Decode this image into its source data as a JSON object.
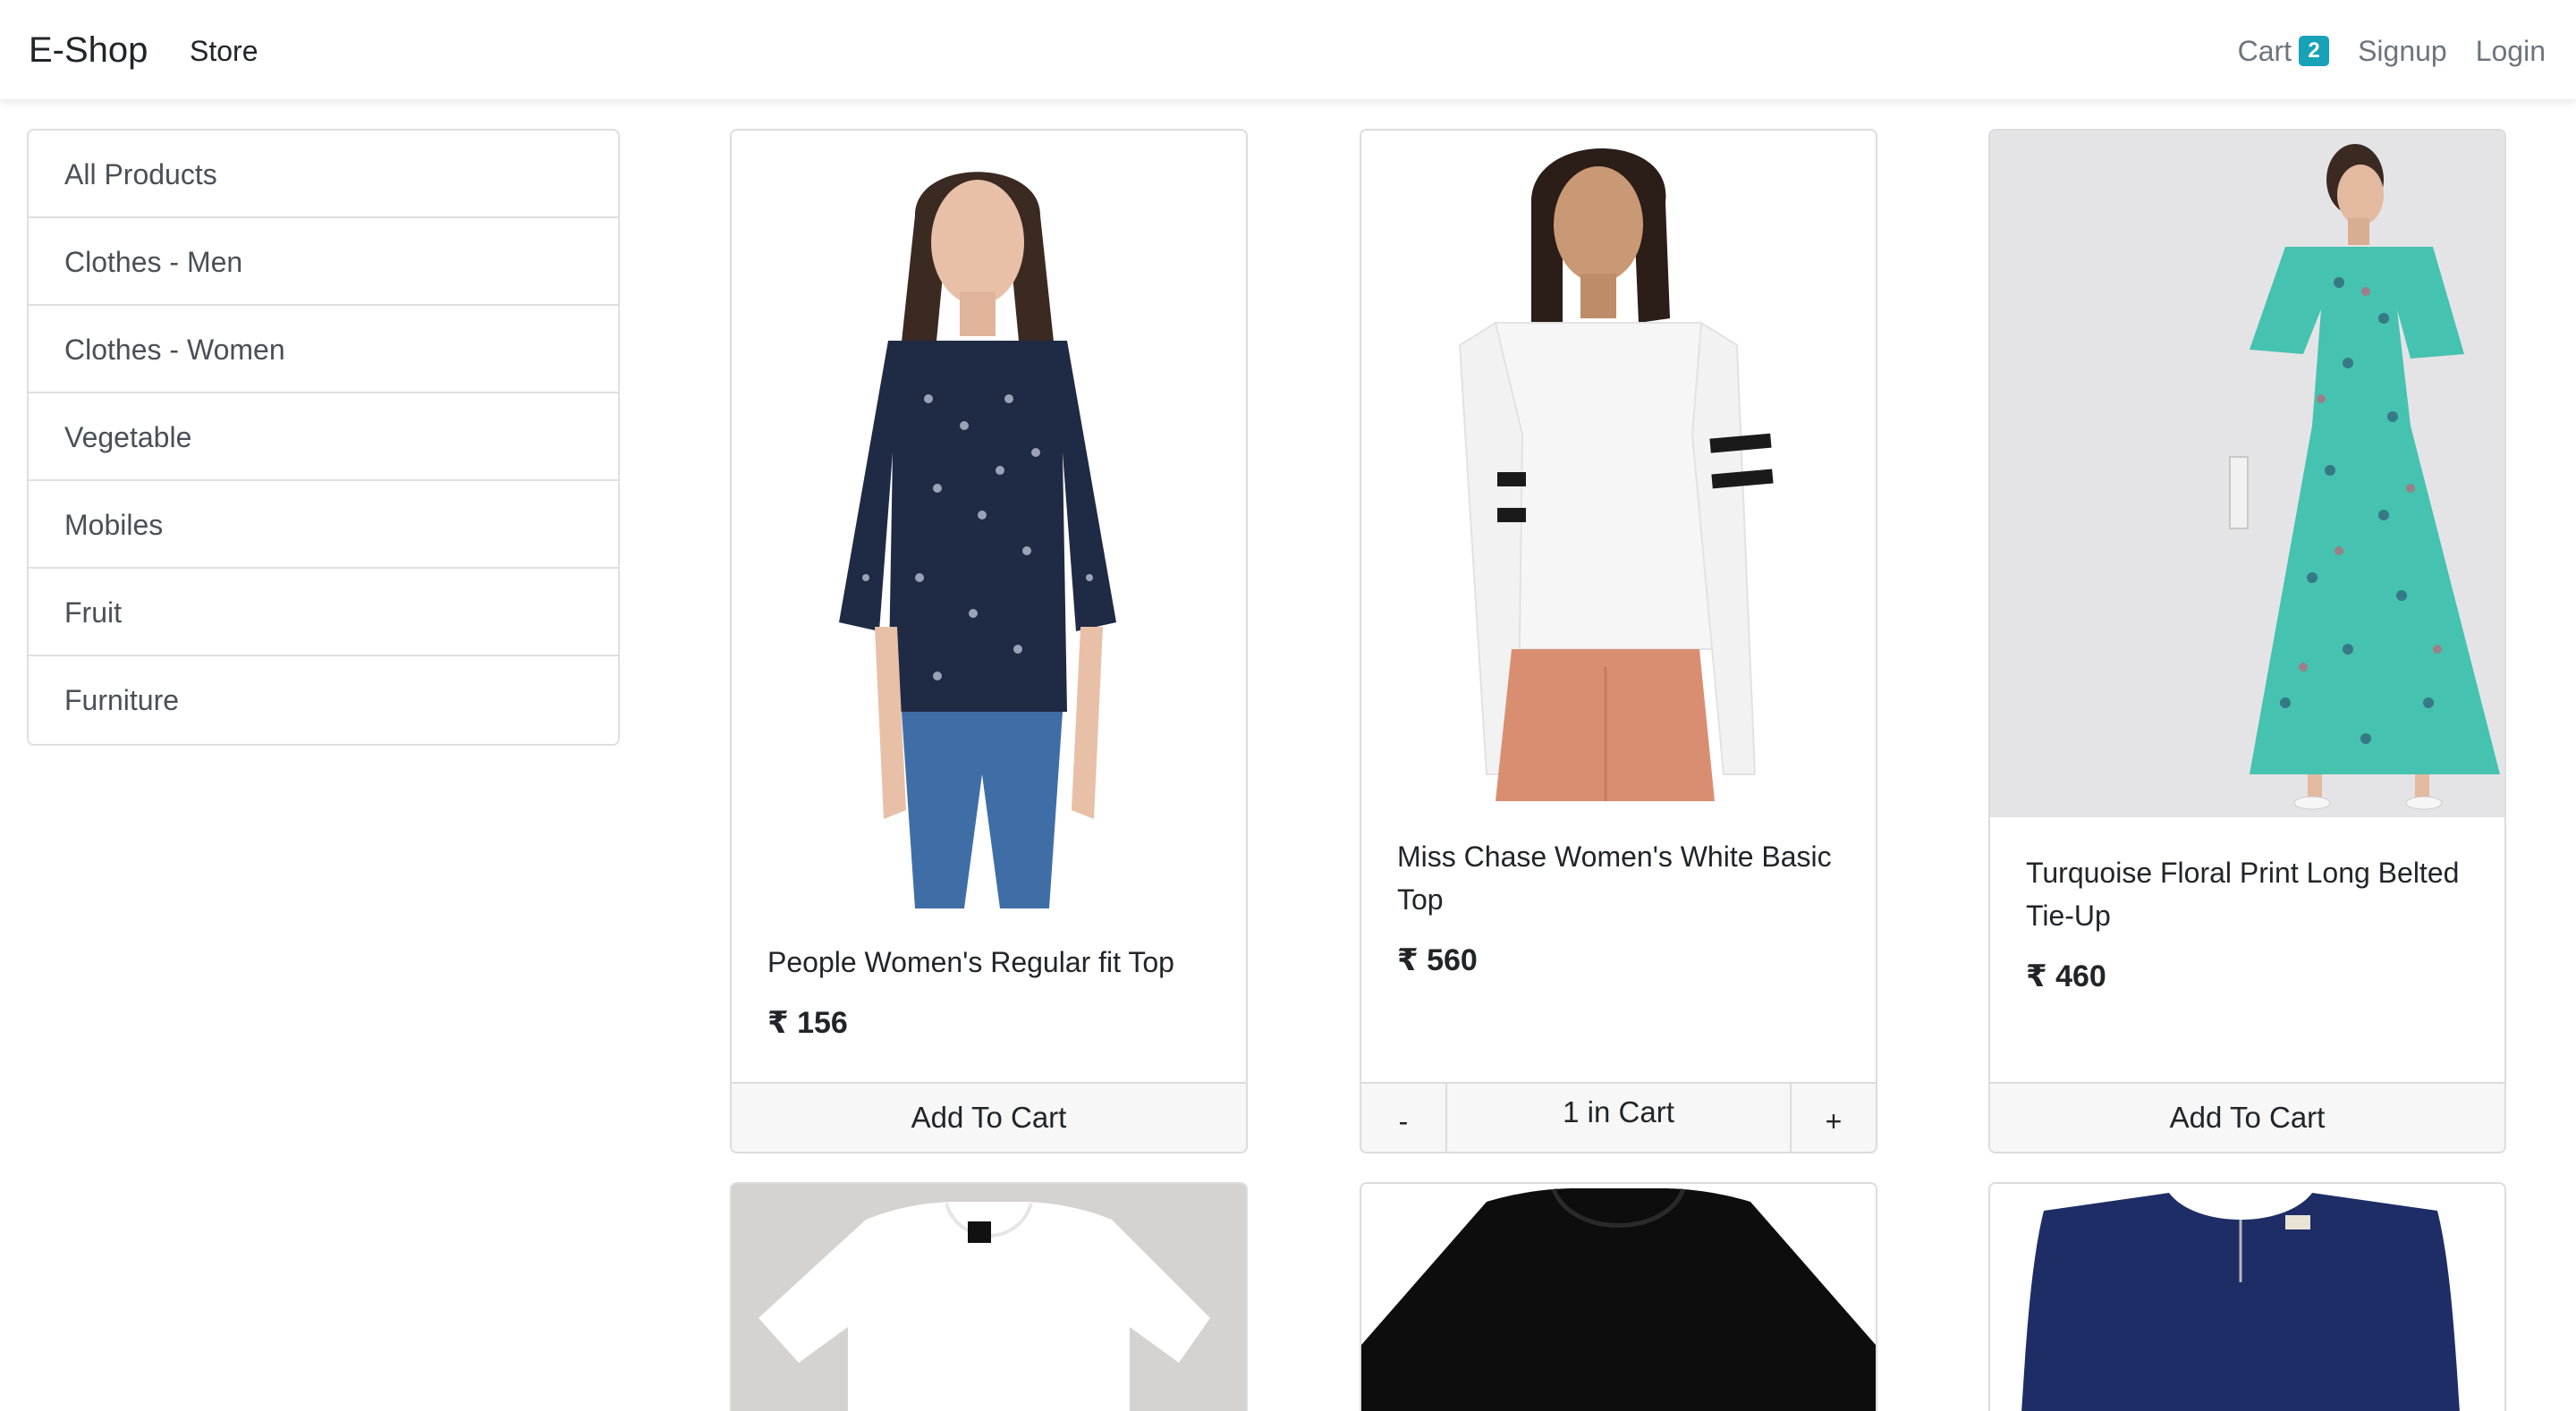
{
  "navbar": {
    "brand": "E-Shop",
    "store_link": "Store",
    "cart_label": "Cart",
    "cart_count": "2",
    "signup_label": "Signup",
    "login_label": "Login",
    "badge_color": "#17a2b8"
  },
  "sidebar": {
    "items": [
      {
        "label": "All Products"
      },
      {
        "label": "Clothes - Men"
      },
      {
        "label": "Clothes - Women"
      },
      {
        "label": "Vegetable"
      },
      {
        "label": "Mobiles"
      },
      {
        "label": "Fruit"
      },
      {
        "label": "Furniture"
      }
    ]
  },
  "products": [
    {
      "title": "People Women's Regular fit Top",
      "price": "₹ 156",
      "action": "Add To Cart",
      "image": "navy-printed-top-photo"
    },
    {
      "title": "Miss Chase Women's White Basic Top",
      "price": "₹ 560",
      "cart_qty_label": "1 in Cart",
      "minus": "-",
      "plus": "+",
      "image": "white-striped-sleeve-top-photo"
    },
    {
      "title": "Turquoise Floral Print Long Belted Tie-Up",
      "price": "₹ 460",
      "action": "Add To Cart",
      "image": "turquoise-floral-dress-photo"
    },
    {
      "image": "white-tshirt-photo"
    },
    {
      "image": "black-top-photo"
    },
    {
      "image": "navy-dress-photo"
    }
  ]
}
